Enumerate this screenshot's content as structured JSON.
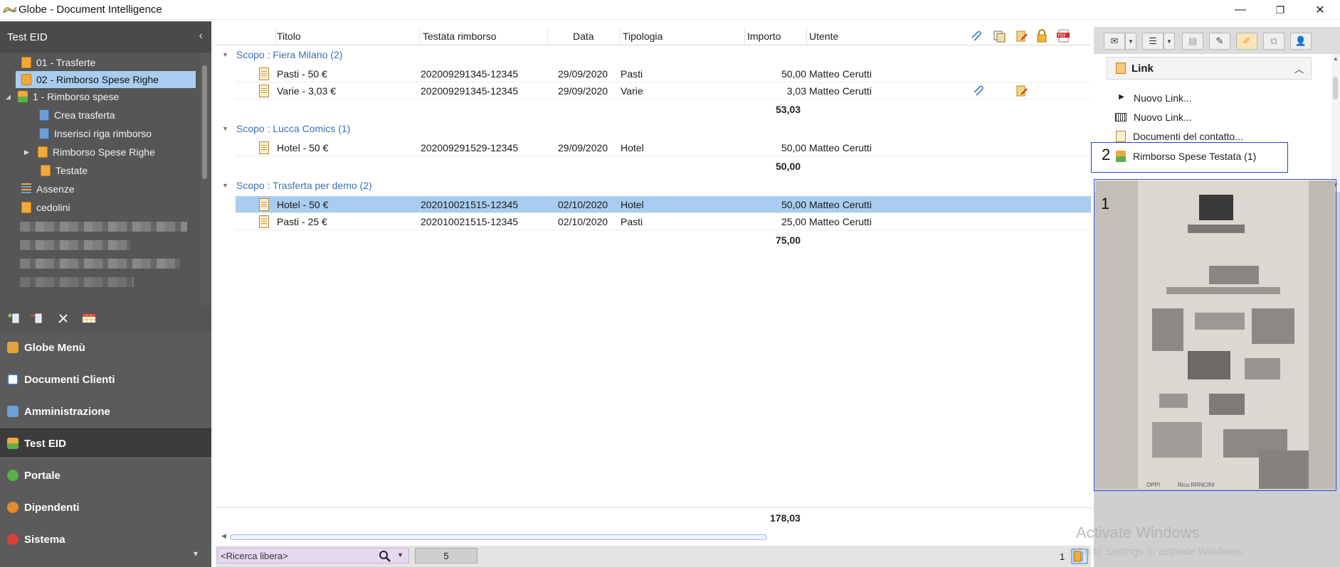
{
  "window": {
    "title": "Globe - Document Intelligence",
    "controls": {
      "minimize": "—",
      "maximize": "❐",
      "close": "✕"
    }
  },
  "sidebar": {
    "title": "Test EID",
    "collapse_glyph": "‹",
    "tree": [
      {
        "label": "01 - Trasferte",
        "icon": "folder-icon"
      },
      {
        "label": "02 -  Rimborso Spese Righe",
        "icon": "folder-icon",
        "selected": true
      },
      {
        "label": "1 - Rimborso spese",
        "icon": "tree-icon",
        "expanded": true
      },
      {
        "label": "Crea trasferta",
        "icon": "grid-icon"
      },
      {
        "label": "Inserisci riga rimborso",
        "icon": "grid-icon"
      },
      {
        "label": "Rimborso Spese Righe",
        "icon": "folder-icon"
      },
      {
        "label": "Testate",
        "icon": "folder-icon"
      },
      {
        "label": "Assenze",
        "icon": "list-icon"
      },
      {
        "label": "cedolini",
        "icon": "folder-icon"
      }
    ],
    "toolbar": [
      "add-node-icon",
      "remove-node-icon",
      "tools-icon",
      "grid-settings-icon"
    ],
    "nav": [
      {
        "label": "Globe Menù",
        "icon": "home-icon",
        "color": "#e4a33a"
      },
      {
        "label": "Documenti Clienti",
        "icon": "document-icon",
        "color": "#3b78c4"
      },
      {
        "label": "Amministrazione",
        "icon": "admin-icon",
        "color": "#6e9fd6"
      },
      {
        "label": "Test EID",
        "icon": "tree-icon",
        "color": "#f2a93b",
        "active": true
      },
      {
        "label": "Portale",
        "icon": "globe-icon",
        "color": "#5ab04a"
      },
      {
        "label": "Dipendenti",
        "icon": "people-icon",
        "color": "#e48a2c"
      },
      {
        "label": "Sistema",
        "icon": "gear-icon",
        "color": "#d9413b"
      }
    ],
    "expand_glyph": "▾"
  },
  "grid": {
    "columns": {
      "titolo": "Titolo",
      "testata": "Testata rimborso",
      "data": "Data",
      "tipologia": "Tipologia",
      "importo": "Importo",
      "utente": "Utente"
    },
    "header_icons": [
      "paperclip-icon",
      "copy-icon",
      "edit-icon",
      "lock-icon",
      "pdf-icon"
    ],
    "groups": [
      {
        "label": "Scopo : Fiera Milano (2)",
        "rows": [
          {
            "titolo": "Pasti - 50 €",
            "testata": "202009291345-12345",
            "data": "29/09/2020",
            "tipologia": "Pasti",
            "importo": "50,00",
            "utente": "Matteo Cerutti"
          },
          {
            "titolo": "Varie - 3,03 €",
            "testata": "202009291345-12345",
            "data": "29/09/2020",
            "tipologia": "Varie",
            "importo": "3,03",
            "utente": "Matteo Cerutti",
            "attachment": true,
            "edit": true
          }
        ],
        "total": "53,03"
      },
      {
        "label": "Scopo : Lucca Comics (1)",
        "rows": [
          {
            "titolo": "Hotel - 50 €",
            "testata": "202009291529-12345",
            "data": "29/09/2020",
            "tipologia": "Hotel",
            "importo": "50,00",
            "utente": "Matteo Cerutti"
          }
        ],
        "total": "50,00"
      },
      {
        "label": "Scopo : Trasferta per demo (2)",
        "rows": [
          {
            "titolo": "Hotel - 50 €",
            "testata": "202010021515-12345",
            "data": "02/10/2020",
            "tipologia": "Hotel",
            "importo": "50,00",
            "utente": "Matteo Cerutti",
            "selected": true
          },
          {
            "titolo": "Pasti - 25 €",
            "testata": "202010021515-12345",
            "data": "02/10/2020",
            "tipologia": "Pasti",
            "importo": "25,00",
            "utente": "Matteo Cerutti"
          }
        ],
        "total": "75,00"
      }
    ],
    "grand_total": "178,03"
  },
  "statusbar": {
    "search_placeholder": "<Ricerca libera>",
    "count": "5",
    "page": "1"
  },
  "right_panel": {
    "toolbar": [
      "mail-icon",
      "dropdown-icon",
      "list-icon",
      "dropdown-icon",
      "scan-icon",
      "pen-icon",
      "edit-icon",
      "copy-icon",
      "user-icon"
    ],
    "link_header": "Link",
    "links": [
      {
        "label": "Nuovo Link...",
        "icon": "play-icon"
      },
      {
        "label": "Nuovo Link...",
        "icon": "barcode-icon"
      },
      {
        "label": "Documenti del contatto...",
        "icon": "document-icon"
      },
      {
        "label": "Rimborso Spese Testata (1)",
        "icon": "tree-icon"
      }
    ],
    "annotations": {
      "box1": "1",
      "box2": "2"
    },
    "preview_caption": [
      "OPPI",
      "Ricu RRNCINI"
    ]
  },
  "watermark": {
    "line1": "Activate Windows",
    "line2": "Go to Settings to activate Windows."
  },
  "colors": {
    "selection": "#a9cdf0",
    "sidebar": "#5b5b5b",
    "group_text": "#3a71b5",
    "annotation_box": "#2a3fd8"
  }
}
